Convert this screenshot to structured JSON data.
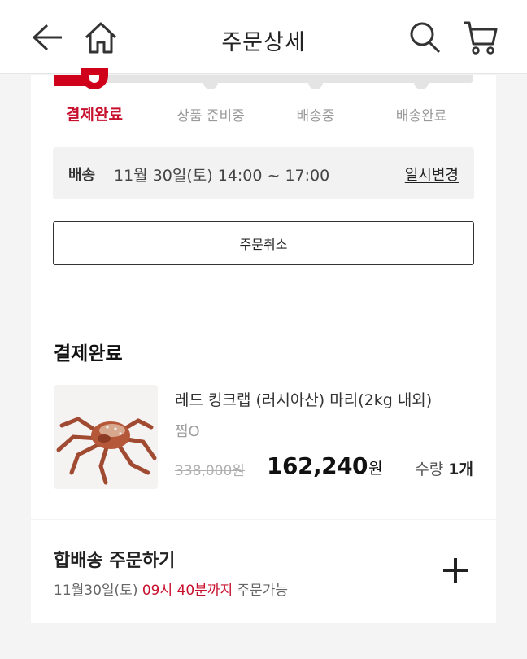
{
  "header": {
    "title": "주문상세",
    "back_icon": "arrow-left-icon",
    "home_icon": "home-icon",
    "search_icon": "search-icon",
    "cart_icon": "cart-icon"
  },
  "progress": {
    "current_step": 0,
    "steps": [
      {
        "label": "결제완료",
        "active": true
      },
      {
        "label": "상품 준비중",
        "active": false
      },
      {
        "label": "배송중",
        "active": false
      },
      {
        "label": "배송완료",
        "active": false
      }
    ],
    "accent_color": "#d0021b"
  },
  "delivery": {
    "label": "배송",
    "value": "11월 30일(토) 14:00 ~ 17:00",
    "change_link": "일시변경"
  },
  "cancel_button": "주문취소",
  "order": {
    "status_title": "결제완료",
    "product_name": "레드 킹크랩 (러시아산) 마리(2kg 내외)",
    "option": "찜O",
    "original_price": "338,000원",
    "sale_price": "162,240",
    "sale_price_unit": "원",
    "qty_label": "수량",
    "qty_value": "1개"
  },
  "combined": {
    "title": "합배송 주문하기",
    "date": "11월30일(토)",
    "deadline": "09시 40분까지",
    "suffix": "주문가능",
    "add_icon": "plus-icon"
  }
}
